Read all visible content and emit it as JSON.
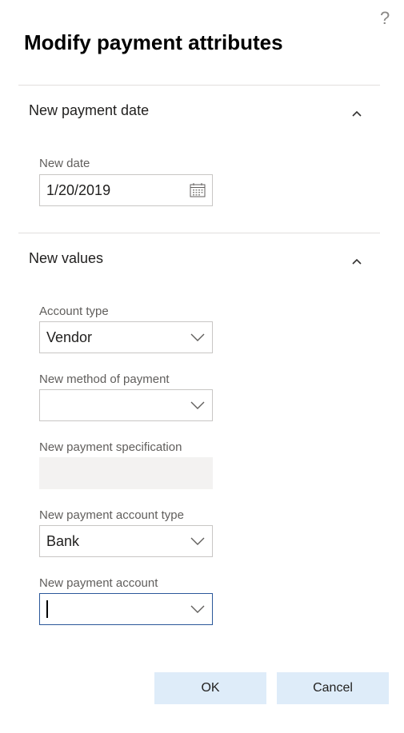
{
  "dialog": {
    "help_glyph": "?",
    "title": "Modify payment attributes"
  },
  "sections": {
    "payment_date": {
      "title": "New payment date",
      "expanded": true,
      "new_date": {
        "label": "New date",
        "value": "1/20/2019",
        "icon": "calendar-icon"
      }
    },
    "new_values": {
      "title": "New values",
      "expanded": true,
      "account_type": {
        "label": "Account type",
        "value": "Vendor"
      },
      "method_of_payment": {
        "label": "New method of payment",
        "value": ""
      },
      "payment_specification": {
        "label": "New payment specification",
        "value": "",
        "disabled": true
      },
      "payment_account_type": {
        "label": "New payment account type",
        "value": "Bank"
      },
      "payment_account": {
        "label": "New payment account",
        "value": "",
        "focused": true
      }
    }
  },
  "buttons": {
    "ok": "OK",
    "cancel": "Cancel"
  },
  "colors": {
    "button_bg": "#deecf9",
    "focus_border": "#2b579a",
    "disabled_bg": "#f3f2f1",
    "label": "#605e5c"
  }
}
